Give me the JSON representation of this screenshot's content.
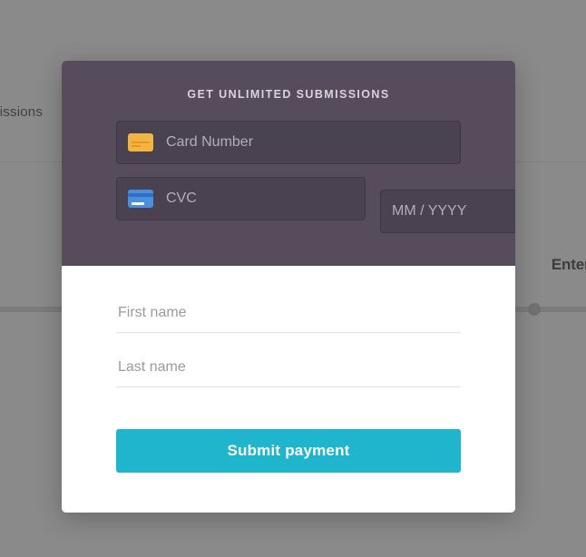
{
  "background": {
    "submissions_label": "ubmissions",
    "plan_label": "Enterprise"
  },
  "modal": {
    "title": "GET UNLIMITED SUBMISSIONS",
    "card_number": {
      "placeholder": "Card Number",
      "value": ""
    },
    "cvc": {
      "placeholder": "CVC",
      "value": ""
    },
    "expiry": {
      "placeholder": "MM / YYYY",
      "value": ""
    },
    "first_name": {
      "placeholder": "First name",
      "value": ""
    },
    "last_name": {
      "placeholder": "Last name",
      "value": ""
    },
    "submit_label": "Submit payment"
  },
  "colors": {
    "modal_top_bg": "#564c5c",
    "accent": "#1fb6cd",
    "icon_orange": "#f3b442",
    "icon_blue": "#4a90e2"
  }
}
